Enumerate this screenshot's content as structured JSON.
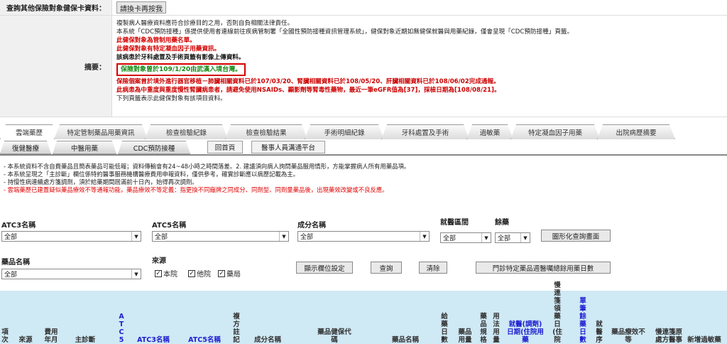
{
  "query": {
    "label": "查詢其他保險對象健保卡資料：",
    "button": "請換卡再按我"
  },
  "summary": {
    "label": "摘要：",
    "lines": [
      "複製病人醫療資料應符合診療目的之用，否則自負相關法律責任。",
      "本系統「CDC預防接種」係提供使用者連線前往疾病管制署「全國性預防接種資訊管理系統」，健保對象近期如無健保就醫與用藥紀錄，僅會呈現「CDC預防接種」頁籤。",
      "此健保對象為管制用藥名單。",
      "此健保對象有特定凝血因子用藥資訊。",
      "該病患於牙科處置及手術頁籤有影像上傳資料。",
      "保險對象曾於109/1/20由武漢入境台灣。",
      "保險個案曾於境外進行器官移植－肺臟相關資料已於107/03/20、腎臟相關資料已於108/05/20、肝臟相關資料已於108/06/02完成通報。",
      "此病患為中重度與重度慢性腎臟病患者，請避免使用NSAIDs、顯影劑等腎毒性藥物，最近一筆eGFR值為[37]，採檢日期為[108/08/21]。",
      "下列頁籤表示此健保對象有該項目資料。"
    ]
  },
  "tabs_row1": [
    "雲端藥歷",
    "特定管制藥品用藥資訊",
    "檢查檢驗紀錄",
    "檢查檢驗結果",
    "手術明細紀錄",
    "牙科處置及手術",
    "過敏藥",
    "特定凝血因子用藥",
    "出院病歷摘要"
  ],
  "tabs_row2": [
    "復健醫療",
    "中醫用藥",
    "CDC預防接種"
  ],
  "buttons_row2": [
    "回首頁",
    "醫事人員溝通平台"
  ],
  "notes": [
    "- 本系統資料不含自費藥品且簡表藥品可能低報；資料傳輸會有24~48小時之時間落差。2. 建議須向病人詢問藥品服用情形，方能掌握病人所有用藥品項。",
    "- 本系統呈現之「主診斷」欄位係特約醫事服務機構醫療費用申報資料，僅供參考，確實診斷應以病歷記載為主。",
    "- 持慢性病連續處方箋調劑，須於給藥期間屆滿前十日內，始得再次調劑。",
    "- 雲端藥歷已建置疑似藥品療效不等通報功能，藥品療效不等定義：指更換不同廠牌之同成分、同劑型、同劑量藥品後，出現藥效改變或不良反應。"
  ],
  "filters": {
    "atc3_label": "ATC3名稱",
    "atc3_value": "全部",
    "atc5_label": "ATC5名稱",
    "atc5_value": "全部",
    "ingredient_label": "成分名稱",
    "ingredient_value": "全部",
    "region_label": "就醫區間",
    "region_value": "全部",
    "remaining_label": "餘藥",
    "remaining_value": "全部",
    "chart_button": "圖形化查詢畫面",
    "drug_label": "藥品名稱",
    "drug_value": "全部",
    "source_label": "來源",
    "source_options": [
      "本院",
      "他院",
      "藥局"
    ],
    "display_button": "顯示欄位設定",
    "search_button": "查詢",
    "clear_button": "清除",
    "outpatient_button": "門診特定藥品週醫囑總餘用藥日數"
  },
  "table_headers": {
    "item": "項次",
    "source": "來源",
    "fee_month": "費用年月",
    "main_diag": "主診斷",
    "atc5_vertical": "ATC5",
    "atc3": "ATC3名稱",
    "atc5": "ATC5名稱",
    "compound": "複方註記",
    "ingredient": "成分名稱",
    "drug_code": "藥品健保代碼",
    "drug_name": "藥品名稱",
    "route": "給藥日數",
    "dosage": "藥品用量",
    "spec": "藥品規格",
    "usage": "用法用量",
    "visit_date": "就醫(調劑)日期(住院用藥",
    "chronic_days": "慢連箋領藥日(住院",
    "single_use": "單筆餘藥日數",
    "seq": "就醫序",
    "drug_effect": "藥品療效不等",
    "chronic_origin": "慢連箋原處方醫事",
    "new_visit": "新增過敏藥"
  }
}
